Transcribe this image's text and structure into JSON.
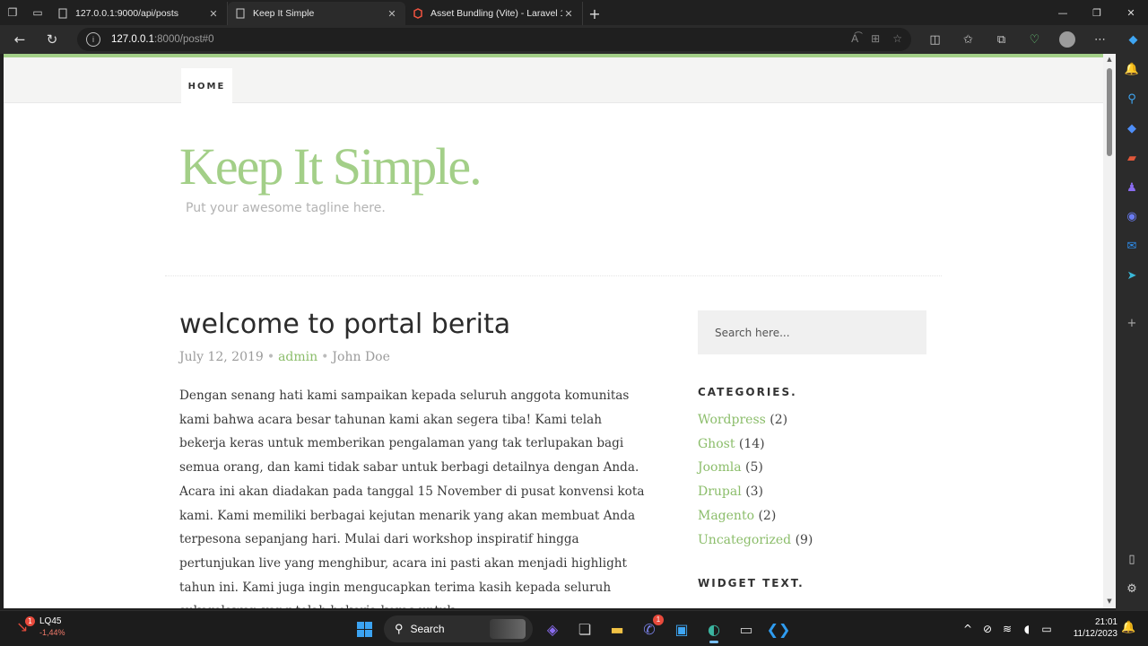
{
  "browser": {
    "tabs": [
      {
        "title": "127.0.0.1:9000/api/posts",
        "active": false
      },
      {
        "title": "Keep It Simple",
        "active": true
      },
      {
        "title": "Asset Bundling (Vite) - Laravel 10",
        "active": false
      }
    ],
    "url_host": "127.0.0.1",
    "url_rest": ":8000/post#0",
    "new_tab": "+",
    "close_glyph": "✕"
  },
  "site": {
    "nav_home": "HOME",
    "title": "Keep It Simple.",
    "tagline": "Put your awesome tagline here."
  },
  "post": {
    "title": "welcome to portal berita",
    "date": "July 12, 2019",
    "author": "admin",
    "name": "John Doe",
    "separator": "•",
    "body": "Dengan senang hati kami sampaikan kepada seluruh anggota komunitas kami bahwa acara besar tahunan kami akan segera tiba! Kami telah bekerja keras untuk memberikan pengalaman yang tak terlupakan bagi semua orang, dan kami tidak sabar untuk berbagi detailnya dengan Anda. Acara ini akan diadakan pada tanggal 15 November di pusat konvensi kota kami. Kami memiliki berbagai kejutan menarik yang akan membuat Anda terpesona sepanjang hari. Mulai dari workshop inspiratif hingga pertunjukan live yang menghibur, acara ini pasti akan menjadi highlight tahun ini. Kami juga ingin mengucapkan terima kasih kepada seluruh sukarelawan yang telah bekerja keras untuk"
  },
  "sidebar": {
    "search_placeholder": "Search here...",
    "categories_title": "CATEGORIES.",
    "categories": [
      {
        "name": "Wordpress",
        "count": "(2)"
      },
      {
        "name": "Ghost",
        "count": "(14)"
      },
      {
        "name": "Joomla",
        "count": "(5)"
      },
      {
        "name": "Drupal",
        "count": "(3)"
      },
      {
        "name": "Magento",
        "count": "(2)"
      },
      {
        "name": "Uncategorized",
        "count": "(9)"
      }
    ],
    "widget_text_title": "WIDGET TEXT."
  },
  "taskbar": {
    "stock_symbol": "LQ45",
    "stock_change": "-1,44%",
    "stock_badge": "1",
    "search_label": "Search",
    "teams_badge": "1",
    "time": "21:01",
    "date": "11/12/2023"
  },
  "colors": {
    "accent_green": "#a3cf88",
    "link_green": "#8bbd6a"
  }
}
